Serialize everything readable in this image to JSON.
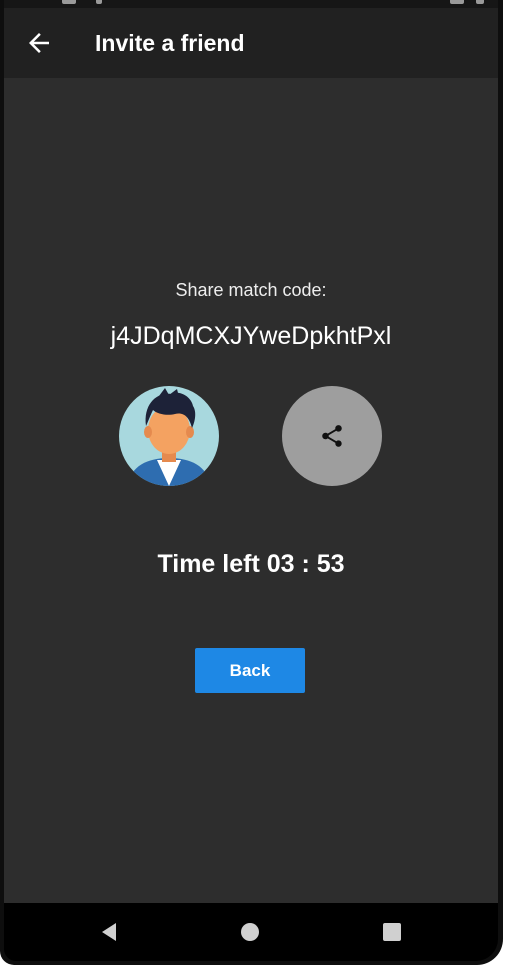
{
  "app_bar": {
    "title": "Invite a friend",
    "back_icon": "arrow-left-icon"
  },
  "main": {
    "share_label": "Share match code:",
    "match_code": "j4JDqMCXJYweDpkhtPxl",
    "avatar_icon": "user-avatar-icon",
    "share_icon": "share-icon",
    "time_left": "Time left 03 : 53",
    "back_button_label": "Back"
  },
  "nav_bar": {
    "back_icon": "nav-back-triangle-icon",
    "home_icon": "nav-home-circle-icon",
    "recents_icon": "nav-recents-square-icon"
  },
  "colors": {
    "app_bar": "#212121",
    "background": "#2d2d2d",
    "accent_button": "#1e88e5",
    "share_circle": "#9e9e9e",
    "avatar_bg": "#a8d8de"
  }
}
